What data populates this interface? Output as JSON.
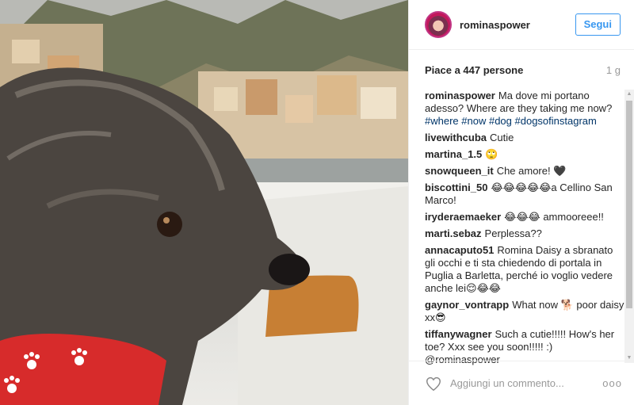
{
  "post": {
    "username": "rominaspower",
    "follow_label": "Segui",
    "likes_text": "Piace a 447 persone",
    "time_ago": "1 g",
    "caption": {
      "user": "rominaspower",
      "text": "Ma dove mi portano adesso? Where are they taking me now?",
      "hashtags": [
        "#where",
        "#now",
        "#dog",
        "#dogsofinstagram"
      ]
    }
  },
  "comments": [
    {
      "user": "livewithcuba",
      "text": "Cutie"
    },
    {
      "user": "martina_1.5",
      "text": "🙄"
    },
    {
      "user": "snowqueen_it",
      "text": "Che amore! 🖤"
    },
    {
      "user": "biscottini_50",
      "text": "😂😂😂😂😂a Cellino San Marco!"
    },
    {
      "user": "iryderaemaeker",
      "text": "😂😂😂 ammooreee!!"
    },
    {
      "user": "marti.sebaz",
      "text": "Perplessa??"
    },
    {
      "user": "annacaputo51",
      "text": "Romina Daisy a sbranato gli occhi e ti sta chiedendo di portala in Puglia a Barletta, perché io voglio vedere anche lei😌😂😂"
    },
    {
      "user": "gaynor_vontrapp",
      "text": "What now 🐕 poor daisy xx😎"
    },
    {
      "user": "tiffanywagner",
      "text": "Such a cutie!!!!! How's her toe? Xxx see you soon!!!!! :) @rominaspower"
    }
  ],
  "footer": {
    "placeholder": "Aggiungi un commento...",
    "more": "ooo"
  },
  "icons": {
    "heart": "heart-icon",
    "more": "more-options-icon"
  },
  "colors": {
    "link": "#3897f0",
    "hashtag": "#003569",
    "muted": "#999999"
  }
}
